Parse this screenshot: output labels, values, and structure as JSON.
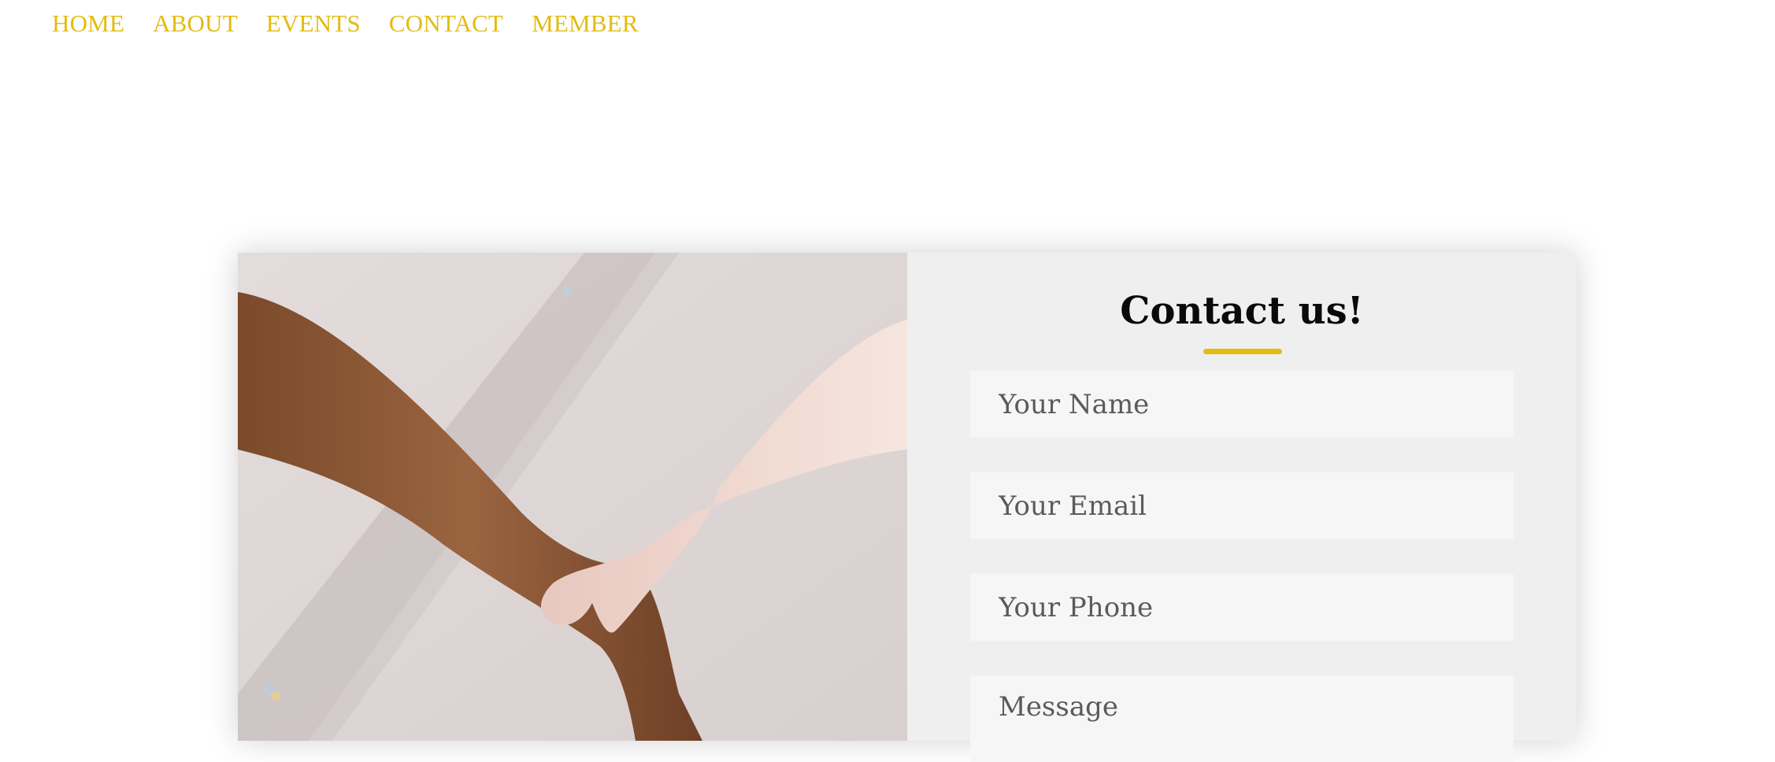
{
  "nav": {
    "items": [
      {
        "label": "HOME"
      },
      {
        "label": "ABOUT"
      },
      {
        "label": "EVENTS"
      },
      {
        "label": "CONTACT"
      },
      {
        "label": "MEMBER"
      }
    ]
  },
  "contact": {
    "title": "Contact us!",
    "fields": {
      "name_placeholder": "Your Name",
      "email_placeholder": "Your Email",
      "phone_placeholder": "Your Phone",
      "message_placeholder": "Message"
    }
  },
  "colors": {
    "accent": "#e3bb12",
    "panel": "#efefef",
    "field": "#f6f6f6"
  }
}
